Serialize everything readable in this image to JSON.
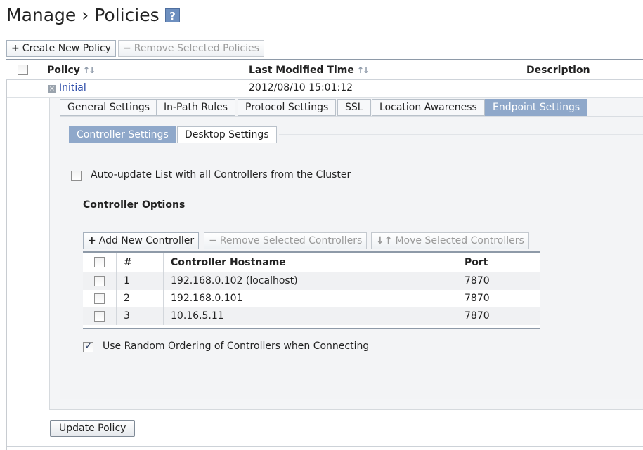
{
  "page": {
    "title": "Manage › Policies",
    "help_glyph": "?"
  },
  "toolbar": {
    "create_label": "Create New Policy",
    "remove_label": "Remove Selected Policies"
  },
  "policies_table": {
    "columns": [
      "Policy",
      "Last Modified Time",
      "Description"
    ],
    "rows": [
      {
        "name": "Initial",
        "modified": "2012/08/10 15:01:12",
        "description": ""
      }
    ]
  },
  "tabs": [
    "General Settings",
    "In-Path Rules",
    "Protocol Settings",
    "SSL",
    "Location Awareness",
    "Endpoint Settings"
  ],
  "active_tab": "Endpoint Settings",
  "subtabs": [
    "Controller Settings",
    "Desktop Settings"
  ],
  "active_subtab": "Controller Settings",
  "auto_update": {
    "label": "Auto-update List with all Controllers from the Cluster",
    "checked": false
  },
  "controller_options": {
    "legend": "Controller Options",
    "buttons": {
      "add": "Add New Controller",
      "remove": "Remove Selected Controllers",
      "move": "Move Selected Controllers"
    },
    "columns": [
      "#",
      "Controller Hostname",
      "Port"
    ],
    "rows": [
      {
        "num": "1",
        "host": "192.168.0.102 (localhost)",
        "port": "7870"
      },
      {
        "num": "2",
        "host": "192.168.0.101",
        "port": "7870"
      },
      {
        "num": "3",
        "host": "10.16.5.11",
        "port": "7870"
      }
    ],
    "random_order": {
      "label": "Use Random Ordering of Controllers when Connecting",
      "checked": true
    }
  },
  "update_button": "Update Policy",
  "colors": {
    "accent_tab": "#8fa8ca",
    "link": "#2a4aa8"
  }
}
